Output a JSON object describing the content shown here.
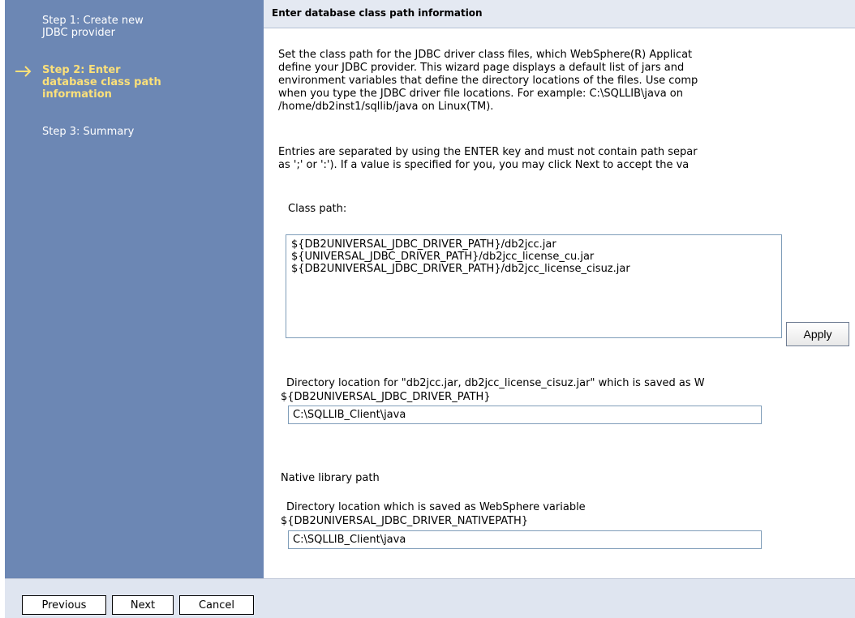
{
  "sidebar": {
    "steps": [
      {
        "label_line1": "Step 1: Create new",
        "label_line2": "JDBC provider"
      },
      {
        "label_line1": "Step 2: Enter",
        "label_line2": "database class path",
        "label_line3": "information"
      },
      {
        "label_line1": "Step 3: Summary"
      }
    ],
    "arrow_icon": "right-arrow-icon"
  },
  "header": {
    "title": "Enter database class path information"
  },
  "intro": {
    "lines": [
      "Set the class path for the JDBC driver class files, which WebSphere(R) Applicat",
      "define your JDBC provider. This wizard page displays a default list of jars and",
      "environment variables that define the directory locations of the files. Use comp",
      "when you type the JDBC driver file locations. For example: C:\\SQLLIB\\java on",
      "/home/db2inst1/sqllib/java on Linux(TM)."
    ],
    "lines2": [
      "Entries are separated by using the ENTER key and must not contain path separ",
      "as ';' or ':'). If a value is specified for you, you may click Next to accept the va"
    ]
  },
  "classpath": {
    "label": "Class path:",
    "entries": [
      "${DB2UNIVERSAL_JDBC_DRIVER_PATH}/db2jcc.jar",
      "${UNIVERSAL_JDBC_DRIVER_PATH}/db2jcc_license_cu.jar",
      "${DB2UNIVERSAL_JDBC_DRIVER_PATH}/db2jcc_license_cisuz.jar"
    ],
    "apply_label": "Apply"
  },
  "dir_location": {
    "label_line1": "Directory location for \"db2jcc.jar, db2jcc_license_cisuz.jar\" which is saved as W",
    "label_line2": "${DB2UNIVERSAL_JDBC_DRIVER_PATH}",
    "value": "C:\\SQLLIB_Client\\java"
  },
  "native": {
    "section_label": "Native library path",
    "label_line1": "Directory location which is saved as WebSphere variable",
    "label_line2": "${DB2UNIVERSAL_JDBC_DRIVER_NATIVEPATH}",
    "value": "C:\\SQLLIB_Client\\java"
  },
  "buttons": {
    "previous": "Previous",
    "next": "Next",
    "cancel": "Cancel"
  },
  "colors": {
    "sidebar_bg": "#6c87b4",
    "active_step": "#fbe07a",
    "header_bg": "#e4e9f2"
  }
}
